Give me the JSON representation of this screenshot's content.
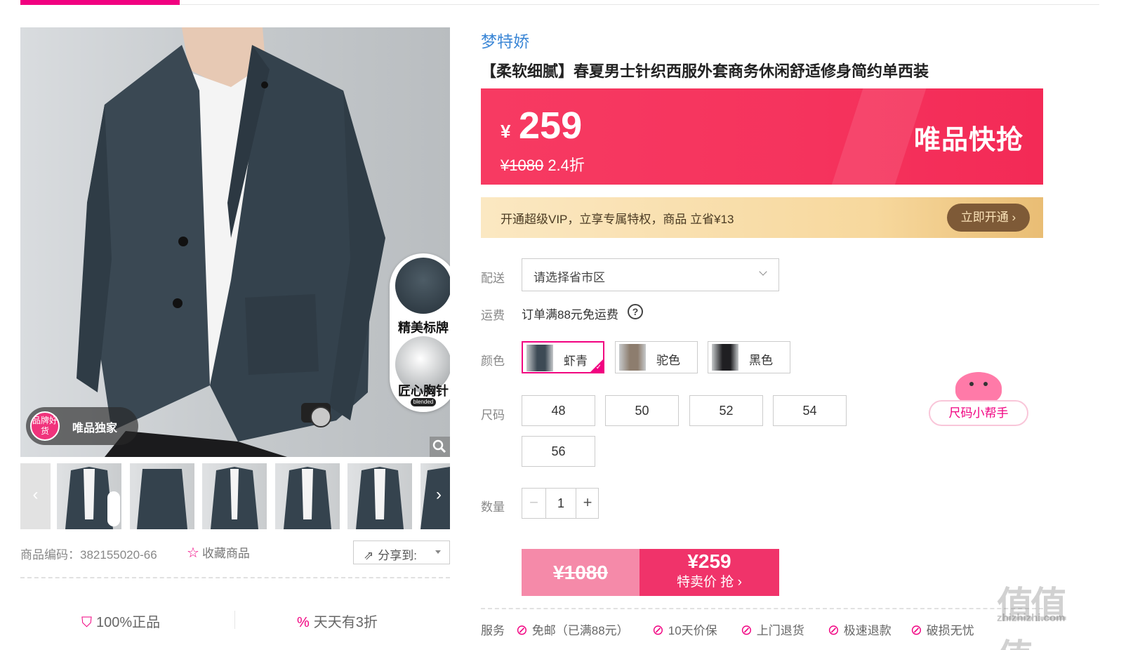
{
  "colors": {
    "accent": "#f10180",
    "brand_blue": "#3c87d6",
    "price_red": "#f5335d",
    "vip_brown": "#7e5a37"
  },
  "gallery": {
    "badges": {
      "label1": "精美标牌",
      "label2": "匠心胸针",
      "mini": "blended"
    },
    "exclusive": {
      "circle": "品牌好货",
      "label": "唯品独家"
    },
    "zoom_icon": "magnifier-icon",
    "prev_icon": "chevron-left-icon",
    "next_icon": "chevron-right-icon"
  },
  "meta": {
    "sku": "商品编码：382155020-66",
    "favorite": "收藏商品",
    "share": "分享到:"
  },
  "guarantees": [
    "100%正品",
    "天天有3折"
  ],
  "product": {
    "brand": "梦特娇",
    "title": "【柔软细腻】春夏男士针织西服外套商务休闲舒适修身简约单西装"
  },
  "price": {
    "currency": "¥",
    "current": "259",
    "original": "¥1080",
    "discount": "2.4折",
    "flash_label": "唯品快抢"
  },
  "vip": {
    "text": "开通超级VIP，立享专属特权，商品 立省¥13",
    "button": "立即开通 ›"
  },
  "delivery": {
    "label": "配送",
    "placeholder": "请选择省市区"
  },
  "shipping": {
    "label": "运费",
    "text": "订单满88元免运费",
    "help": "?"
  },
  "color": {
    "label": "颜色",
    "options": [
      {
        "name": "虾青",
        "selected": true,
        "swatch": "#3d4a55"
      },
      {
        "name": "驼色",
        "selected": false,
        "swatch": "#8d7d6e"
      },
      {
        "name": "黑色",
        "selected": false,
        "swatch": "#1f1f22"
      }
    ]
  },
  "size": {
    "label": "尺码",
    "options": [
      "48",
      "50",
      "52",
      "54",
      "56"
    ]
  },
  "size_helper": "尺码小帮手",
  "quantity": {
    "label": "数量",
    "value": "1",
    "minus": "−",
    "plus": "+"
  },
  "buy": {
    "original": "¥1080",
    "price": "¥259",
    "label": "特卖价 抢 ›"
  },
  "services": {
    "label": "服务",
    "items": [
      "免邮（已满88元）",
      "10天价保",
      "上门退货",
      "极速退款",
      "破损无忧"
    ]
  },
  "watermark": {
    "main": "值值值",
    "sub": "zhizhizhi.com"
  }
}
